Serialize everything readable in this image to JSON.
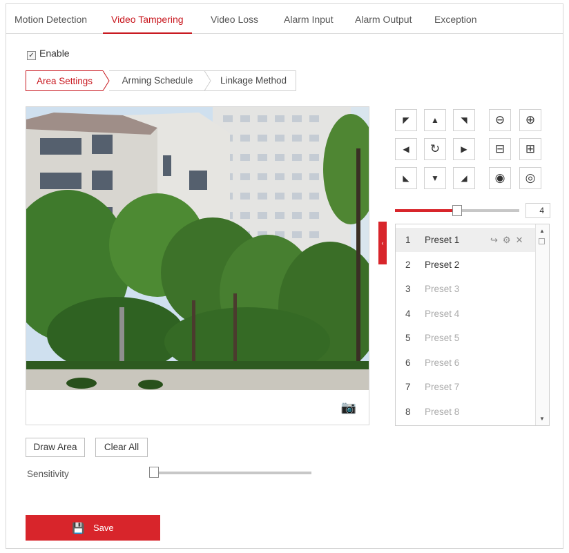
{
  "top_tabs": [
    "Motion Detection",
    "Video Tampering",
    "Video Loss",
    "Alarm Input",
    "Alarm Output",
    "Exception"
  ],
  "active_top_tab": "Video Tampering",
  "enable": {
    "label": "Enable",
    "checked": true,
    "check_glyph": "✓"
  },
  "sub_tabs": [
    "Area Settings",
    "Arming Schedule",
    "Linkage Method"
  ],
  "active_sub_tab": "Area Settings",
  "video": {
    "snapshot_icon": "camera-icon"
  },
  "ptz": {
    "speed_value": "4",
    "speed_fraction": 0.5,
    "icons": {
      "up_left": "◤",
      "up": "▲",
      "up_right": "◥",
      "left": "◀",
      "auto_scan": "↻",
      "right": "▶",
      "down_left": "◣",
      "down": "▼",
      "down_right": "◢",
      "zoom_out": "⊖",
      "zoom_in": "⊕",
      "focus_near": "⊟",
      "focus_far": "⊞",
      "iris_close": "◉",
      "iris_open": "◎"
    },
    "collapse_glyph": "‹"
  },
  "presets": [
    {
      "num": "1",
      "name": "Preset 1",
      "configured": true
    },
    {
      "num": "2",
      "name": "Preset 2",
      "configured": true
    },
    {
      "num": "3",
      "name": "Preset 3",
      "configured": false
    },
    {
      "num": "4",
      "name": "Preset 4",
      "configured": false
    },
    {
      "num": "5",
      "name": "Preset 5",
      "configured": false
    },
    {
      "num": "6",
      "name": "Preset 6",
      "configured": false
    },
    {
      "num": "7",
      "name": "Preset 7",
      "configured": false
    },
    {
      "num": "8",
      "name": "Preset 8",
      "configured": false
    }
  ],
  "preset_action_glyphs": {
    "call": "↪",
    "settings": "⚙",
    "delete": "✕"
  },
  "scroll_glyphs": {
    "up": "▲",
    "down": "▼"
  },
  "buttons": {
    "draw_area": "Draw Area",
    "clear_all": "Clear All",
    "save": "Save",
    "save_icon": "💾"
  },
  "sensitivity": {
    "label": "Sensitivity",
    "value_fraction": 0.0
  },
  "colors": {
    "accent": "#d8252b",
    "active_text": "#c8161d"
  }
}
